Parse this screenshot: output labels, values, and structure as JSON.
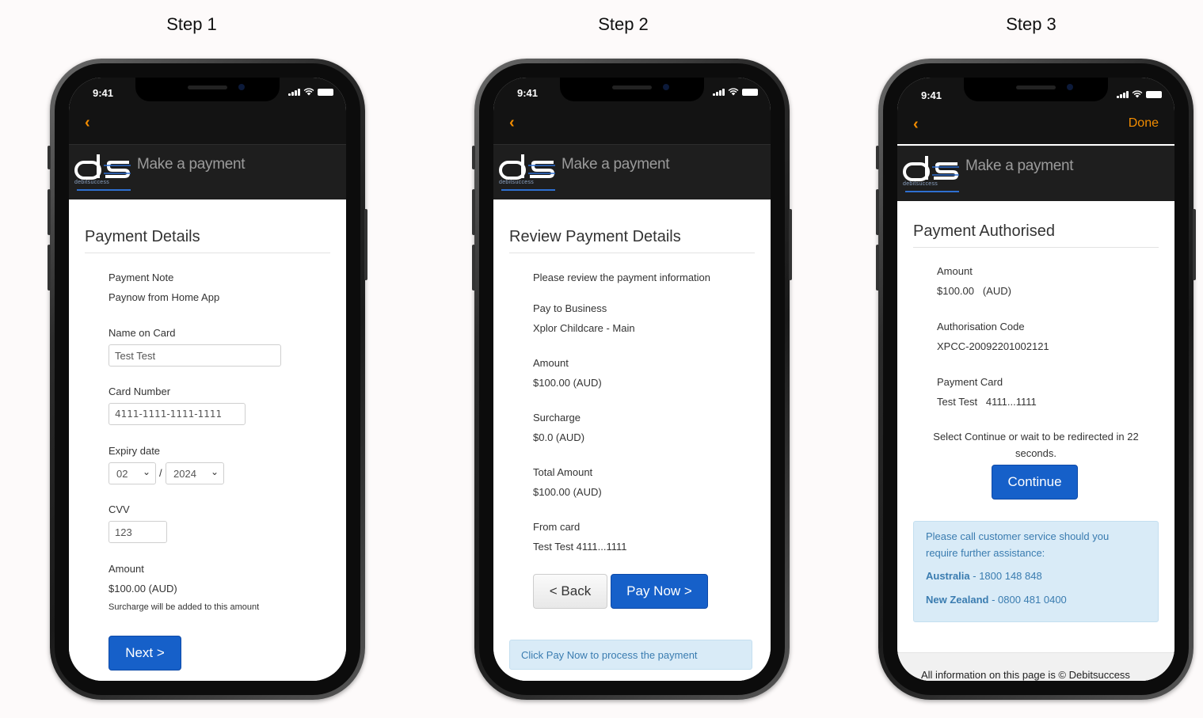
{
  "steps": [
    {
      "title": "Step 1"
    },
    {
      "title": "Step 2"
    },
    {
      "title": "Step 3"
    }
  ],
  "common": {
    "time": "9:41",
    "app_title": "Make a payment",
    "logo_text": "ds",
    "logo_sub": "debitsuccess",
    "back_glyph": "‹"
  },
  "step1": {
    "heading": "Payment Details",
    "payment_note_label": "Payment Note",
    "payment_note_value": "Paynow from Home App",
    "name_label": "Name on Card",
    "name_value": "Test Test",
    "card_label": "Card Number",
    "card_value": "4111-1111-1111-1111",
    "expiry_label": "Expiry date",
    "expiry_month": "02",
    "expiry_sep": "/",
    "expiry_year": "2024",
    "cvv_label": "CVV",
    "cvv_value": "123",
    "amount_label": "Amount",
    "amount_value": "$100.00 (AUD)",
    "surcharge_note": "Surcharge will be added to this amount",
    "next_button": "Next >"
  },
  "step2": {
    "heading": "Review Payment Details",
    "intro": "Please review the payment information",
    "business_label": "Pay to Business",
    "business_value": "Xplor Childcare - Main",
    "amount_label": "Amount",
    "amount_value": "$100.00 (AUD)",
    "surcharge_label": "Surcharge",
    "surcharge_value": "$0.0 (AUD)",
    "total_label": "Total Amount",
    "total_value": "$100.00 (AUD)",
    "card_label": "From card",
    "card_value": "Test Test 4111...1111",
    "back_button": "< Back",
    "paynow_button": "Pay Now >",
    "info_text": "Click Pay Now to process the payment"
  },
  "step3": {
    "done_label": "Done",
    "heading": "Payment Authorised",
    "amount_label": "Amount",
    "amount_value": "$100.00   (AUD)",
    "auth_label": "Authorisation Code",
    "auth_value": "XPCC-20092201002121",
    "card_label": "Payment Card",
    "card_value": "Test Test   4111...1111",
    "redirect_line1": "Select Continue or wait to be redirected in 22",
    "redirect_line2": "seconds.",
    "continue_button": "Continue",
    "help_line1": "Please call customer service should you",
    "help_line2": "require further assistance:",
    "au_label": "Australia",
    "au_number": " - 1800 148 848",
    "nz_label": "New Zealand",
    "nz_number": " - 0800 481 0400",
    "footer_text": "All information on this page is © Debitsuccess"
  }
}
